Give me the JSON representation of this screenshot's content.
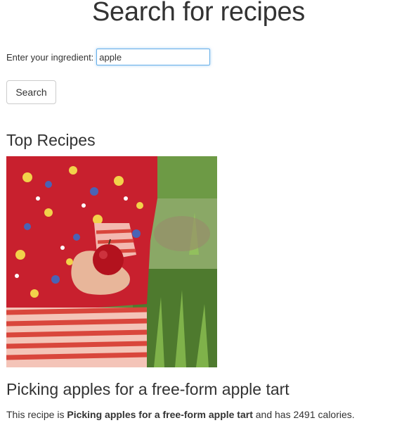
{
  "header": {
    "title": "Search for recipes"
  },
  "search": {
    "label": "Enter your ingredient:",
    "value": "apple",
    "button_label": "Search"
  },
  "results": {
    "heading": "Top Recipes",
    "recipe": {
      "title": "Picking apples for a free-form apple tart",
      "desc_prefix": "This recipe is ",
      "desc_name": "Picking apples for a free-form apple tart",
      "desc_middle": " and has ",
      "calories": "2491",
      "desc_suffix": " calories."
    }
  }
}
